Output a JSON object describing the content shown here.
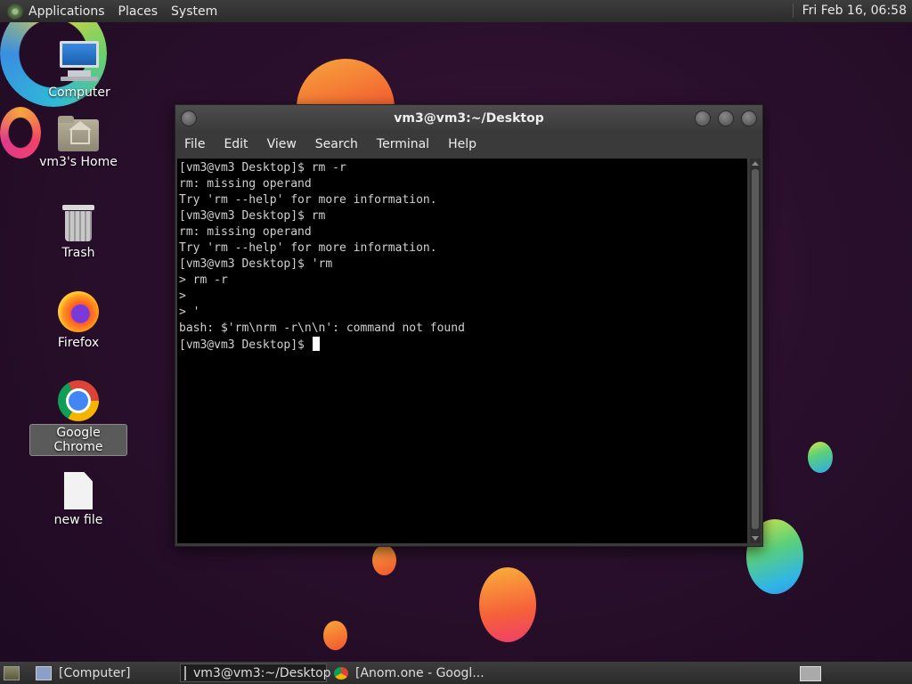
{
  "top_panel": {
    "menus": [
      "Applications",
      "Places",
      "System"
    ],
    "clock": "Fri Feb 16, 06:58"
  },
  "desktop": {
    "icons": [
      {
        "label": "Computer",
        "icon": "computer-icon"
      },
      {
        "label": "vm3's Home",
        "icon": "home-folder-icon"
      },
      {
        "label": "Trash",
        "icon": "trash-icon"
      },
      {
        "label": "Firefox",
        "icon": "firefox-icon"
      },
      {
        "label": "Google Chrome",
        "icon": "chrome-icon",
        "selected": true
      },
      {
        "label": "new file",
        "icon": "file-icon"
      }
    ]
  },
  "terminal": {
    "title": "vm3@vm3:~/Desktop",
    "menu": [
      "File",
      "Edit",
      "View",
      "Search",
      "Terminal",
      "Help"
    ],
    "lines": [
      "[vm3@vm3 Desktop]$ rm -r",
      "rm: missing operand",
      "Try 'rm --help' for more information.",
      "[vm3@vm3 Desktop]$ rm",
      "rm: missing operand",
      "Try 'rm --help' for more information.",
      "[vm3@vm3 Desktop]$ 'rm",
      "> rm -r",
      ">",
      "> '",
      "bash: $'rm\\nrm -r\\n\\n': command not found"
    ],
    "prompt": "[vm3@vm3 Desktop]$ "
  },
  "taskbar": {
    "tasks": [
      {
        "label": "[Computer]",
        "icon": "computer-icon",
        "active": false
      },
      {
        "label": "vm3@vm3:~/Desktop",
        "icon": "terminal-icon",
        "active": true
      },
      {
        "label": "[Anom.one - Googl...",
        "icon": "chrome-icon",
        "active": false
      }
    ]
  }
}
